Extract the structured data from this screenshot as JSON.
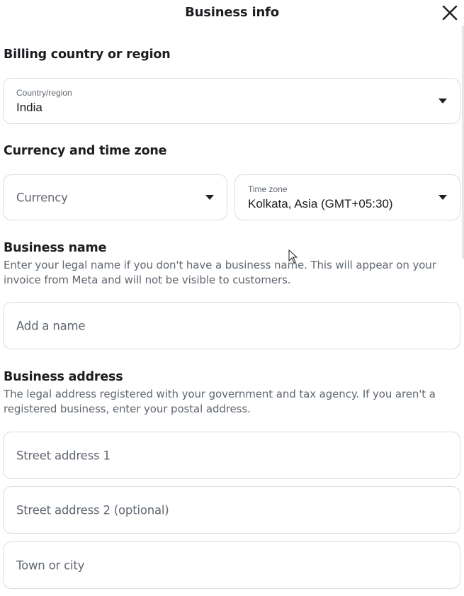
{
  "header": {
    "title": "Business info",
    "close_icon": "close-icon"
  },
  "billing": {
    "title": "Billing country or region",
    "country": {
      "label": "Country/region",
      "value": "India"
    }
  },
  "currency_timezone": {
    "title": "Currency and time zone",
    "currency": {
      "placeholder": "Currency"
    },
    "timezone": {
      "label": "Time zone",
      "value": "Kolkata, Asia (GMT+05:30)"
    }
  },
  "business_name": {
    "title": "Business name",
    "description": "Enter your legal name if you don't have a business name. This will appear on your invoice from Meta and will not be visible to customers.",
    "input": {
      "placeholder": "Add a name",
      "value": ""
    }
  },
  "business_address": {
    "title": "Business address",
    "description": "The legal address registered with your government and tax agency. If you aren't a registered business, enter your postal address.",
    "street1": {
      "placeholder": "Street address 1",
      "value": ""
    },
    "street2": {
      "placeholder": "Street address 2 (optional)",
      "value": ""
    },
    "city": {
      "placeholder": "Town or city",
      "value": ""
    }
  },
  "colors": {
    "border": "#dadde1",
    "text": "#1c1e21",
    "secondary": "#606770"
  }
}
